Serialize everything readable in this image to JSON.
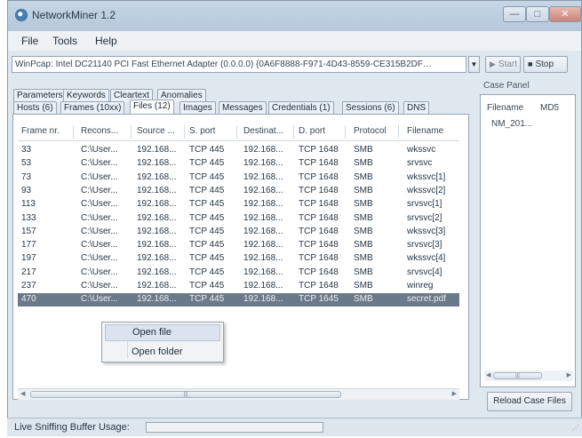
{
  "window": {
    "title": "NetworkMiner 1.2",
    "buttons": {
      "minimize": "—",
      "maximize": "□",
      "close": "✕"
    }
  },
  "menu": [
    "File",
    "Tools",
    "Help"
  ],
  "adapter": {
    "selected": "WinPcap: Intel DC21140 PCI Fast Ethernet Adapter (0.0.0.0) {0A6F8888-F971-4D43-8559-CE315B2DF…",
    "start_label": "Start",
    "stop_label": "Stop"
  },
  "tabs_row1": [
    "Parameters",
    "Keywords",
    "Cleartext",
    "Anomalies"
  ],
  "tabs_row2": [
    "Hosts (6)",
    "Frames (10xx)",
    "Files (12)",
    "Images",
    "Messages",
    "Credentials (1)",
    "Sessions (6)",
    "DNS"
  ],
  "active_tab": "Files (12)",
  "table": {
    "columns": [
      "Frame nr.",
      "Recons...",
      "Source ...",
      "S. port",
      "Destinat...",
      "D. port",
      "Protocol",
      "Filename"
    ],
    "rows": [
      [
        "33",
        "C:\\User...",
        "192.168...",
        "TCP 445",
        "192.168...",
        "TCP 1648",
        "SMB",
        "wkssvc"
      ],
      [
        "53",
        "C:\\User...",
        "192.168...",
        "TCP 445",
        "192.168...",
        "TCP 1648",
        "SMB",
        "srvsvc"
      ],
      [
        "73",
        "C:\\User...",
        "192.168...",
        "TCP 445",
        "192.168...",
        "TCP 1648",
        "SMB",
        "wkssvc[1]"
      ],
      [
        "93",
        "C:\\User...",
        "192.168...",
        "TCP 445",
        "192.168...",
        "TCP 1648",
        "SMB",
        "wkssvc[2]"
      ],
      [
        "113",
        "C:\\User...",
        "192.168...",
        "TCP 445",
        "192.168...",
        "TCP 1648",
        "SMB",
        "srvsvc[1]"
      ],
      [
        "133",
        "C:\\User...",
        "192.168...",
        "TCP 445",
        "192.168...",
        "TCP 1648",
        "SMB",
        "srvsvc[2]"
      ],
      [
        "157",
        "C:\\User...",
        "192.168...",
        "TCP 445",
        "192.168...",
        "TCP 1648",
        "SMB",
        "wkssvc[3]"
      ],
      [
        "177",
        "C:\\User...",
        "192.168...",
        "TCP 445",
        "192.168...",
        "TCP 1648",
        "SMB",
        "srvsvc[3]"
      ],
      [
        "197",
        "C:\\User...",
        "192.168...",
        "TCP 445",
        "192.168...",
        "TCP 1648",
        "SMB",
        "wkssvc[4]"
      ],
      [
        "217",
        "C:\\User...",
        "192.168...",
        "TCP 445",
        "192.168...",
        "TCP 1648",
        "SMB",
        "srvsvc[4]"
      ],
      [
        "237",
        "C:\\User...",
        "192.168...",
        "TCP 445",
        "192.168...",
        "TCP 1648",
        "SMB",
        "winreg"
      ],
      [
        "470",
        "C:\\User...",
        "192.168...",
        "TCP 445",
        "192.168...",
        "TCP 1645",
        "SMB",
        "secret.pdf"
      ]
    ],
    "selected_row": 11
  },
  "context_menu": [
    "Open file",
    "Open folder"
  ],
  "scrollbar_grip": "|||",
  "case_panel": {
    "label": "Case Panel",
    "columns": [
      "Filename",
      "MD5"
    ],
    "rows": [
      [
        "NM_201...",
        ""
      ]
    ],
    "reload_label": "Reload Case Files"
  },
  "status": {
    "buffer_label": "Live Sniffing Buffer Usage:"
  },
  "colors": {
    "accent": "#6b7a8a",
    "window_bg": "#dfe7ef",
    "titlebar": "#b5c7da"
  }
}
